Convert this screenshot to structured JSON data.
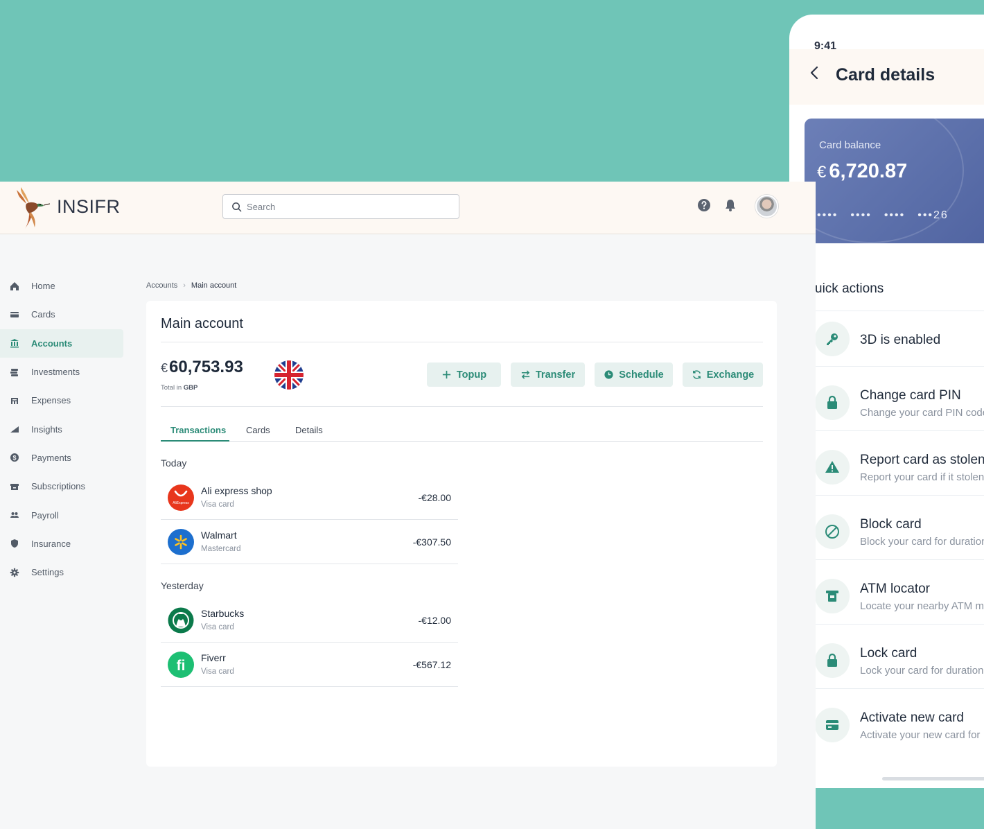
{
  "phone": {
    "status_time": "9:41",
    "title": "Card details",
    "card": {
      "label": "Card balance",
      "currency": "€",
      "balance": "6,720.87",
      "number_groups": [
        "••••",
        "••••",
        "••••",
        "•••26"
      ]
    },
    "quick_actions_title": "uick actions",
    "quick_actions": [
      {
        "name": "3D is enabled",
        "sub": "",
        "icon": "key-icon"
      },
      {
        "name": "Change card PIN",
        "sub": "Change your card PIN code",
        "icon": "lock-icon"
      },
      {
        "name": "Report card as stolen",
        "sub": "Report your card if it stolen",
        "icon": "warning-icon"
      },
      {
        "name": "Block card",
        "sub": "Block your card for duration",
        "icon": "block-icon"
      },
      {
        "name": "ATM locator",
        "sub": "Locate your nearby ATM m",
        "icon": "atm-icon"
      },
      {
        "name": "Lock card",
        "sub": "Lock your card for duration",
        "icon": "lock-icon"
      },
      {
        "name": "Activate new card",
        "sub": "Activate your new card for",
        "icon": "card-icon"
      }
    ]
  },
  "app": {
    "brand": "INSIFR",
    "search_placeholder": "Search",
    "sidebar": [
      {
        "label": "Home",
        "icon": "home-icon"
      },
      {
        "label": "Cards",
        "icon": "card-icon"
      },
      {
        "label": "Accounts",
        "icon": "bank-icon",
        "active": true
      },
      {
        "label": "Investments",
        "icon": "investments-icon"
      },
      {
        "label": "Expenses",
        "icon": "expenses-icon"
      },
      {
        "label": "Insights",
        "icon": "chart-icon"
      },
      {
        "label": "Payments",
        "icon": "dollar-icon"
      },
      {
        "label": "Subscriptions",
        "icon": "subscriptions-icon"
      },
      {
        "label": "Payroll",
        "icon": "people-icon"
      },
      {
        "label": "Insurance",
        "icon": "shield-icon"
      },
      {
        "label": "Settings",
        "icon": "gear-icon"
      }
    ],
    "breadcrumb": {
      "parent": "Accounts",
      "current": "Main account"
    },
    "account": {
      "title": "Main account",
      "currency": "€",
      "balance": "60,753.93",
      "total_label": "Total in",
      "total_currency": "GBP"
    },
    "actions": {
      "topup": "Topup",
      "transfer": "Transfer",
      "schedule": "Schedule",
      "exchange": "Exchange"
    },
    "tabs": {
      "transactions": "Transactions",
      "cards": "Cards",
      "details": "Details"
    },
    "groups": {
      "today": {
        "label": "Today",
        "items": [
          {
            "name": "Ali express shop",
            "sub": "Visa card",
            "amount": "-€28.00",
            "logo_text": "AliExpress"
          },
          {
            "name": "Walmart",
            "sub": "Mastercard",
            "amount": "-€307.50"
          }
        ]
      },
      "yesterday": {
        "label": "Yesterday",
        "items": [
          {
            "name": "Starbucks",
            "sub": "Visa card",
            "amount": "-€12.00"
          },
          {
            "name": "Fiverr",
            "sub": "Visa card",
            "amount": "-€567.12",
            "logo_text": "fi"
          }
        ]
      }
    }
  },
  "colors": {
    "accent": "#2b8b77",
    "background": "#6fc5b7",
    "card": "#5a6ea9"
  }
}
